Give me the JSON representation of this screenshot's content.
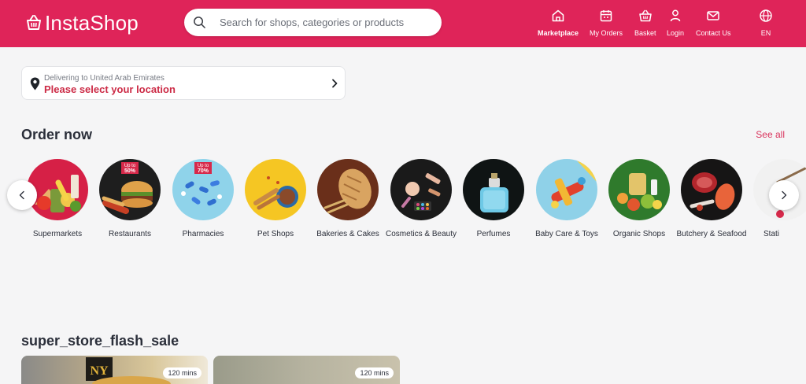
{
  "brand": {
    "name": "InstaShop",
    "icon": "basket-logo-icon",
    "color": "#df2459"
  },
  "search": {
    "placeholder": "Search for shops, categories or products",
    "value": ""
  },
  "nav": {
    "items": [
      {
        "label": "Marketplace",
        "icon": "home-icon",
        "active": true
      },
      {
        "label": "My Orders",
        "icon": "calendar-icon",
        "active": false
      },
      {
        "label": "Basket",
        "icon": "basket-icon",
        "active": false
      },
      {
        "label": "Login",
        "icon": "user-icon",
        "active": false
      },
      {
        "label": "Contact Us",
        "icon": "mail-icon",
        "active": false
      },
      {
        "label": "EN",
        "icon": "globe-icon",
        "active": false
      }
    ]
  },
  "location": {
    "subtitle": "Delivering to United Arab Emirates",
    "prompt": "Please select your location",
    "accent": "#cc2b46"
  },
  "order_now": {
    "title": "Order now",
    "see_all": "See all",
    "categories": [
      {
        "label": "Supermarkets",
        "icon": "groceries-image"
      },
      {
        "label": "Restaurants",
        "icon": "burger-image",
        "promo": "Up to 50%"
      },
      {
        "label": "Pharmacies",
        "icon": "pills-image",
        "promo": "Up to 70%"
      },
      {
        "label": "Pet Shops",
        "icon": "pet-food-image"
      },
      {
        "label": "Bakeries & Cakes",
        "icon": "bread-image"
      },
      {
        "label": "Cosmetics & Beauty",
        "icon": "makeup-image"
      },
      {
        "label": "Perfumes",
        "icon": "perfume-bottle-image"
      },
      {
        "label": "Baby Care & Toys",
        "icon": "toy-plane-image"
      },
      {
        "label": "Organic Shops",
        "icon": "organic-produce-image"
      },
      {
        "label": "Butchery & Seafood",
        "icon": "meat-image"
      },
      {
        "label": "Stati",
        "icon": "stationery-image"
      }
    ]
  },
  "flash_sale": {
    "title": "super_store_flash_sale",
    "cards": [
      {
        "badge": "120 mins"
      },
      {
        "badge": "120 mins"
      }
    ]
  }
}
